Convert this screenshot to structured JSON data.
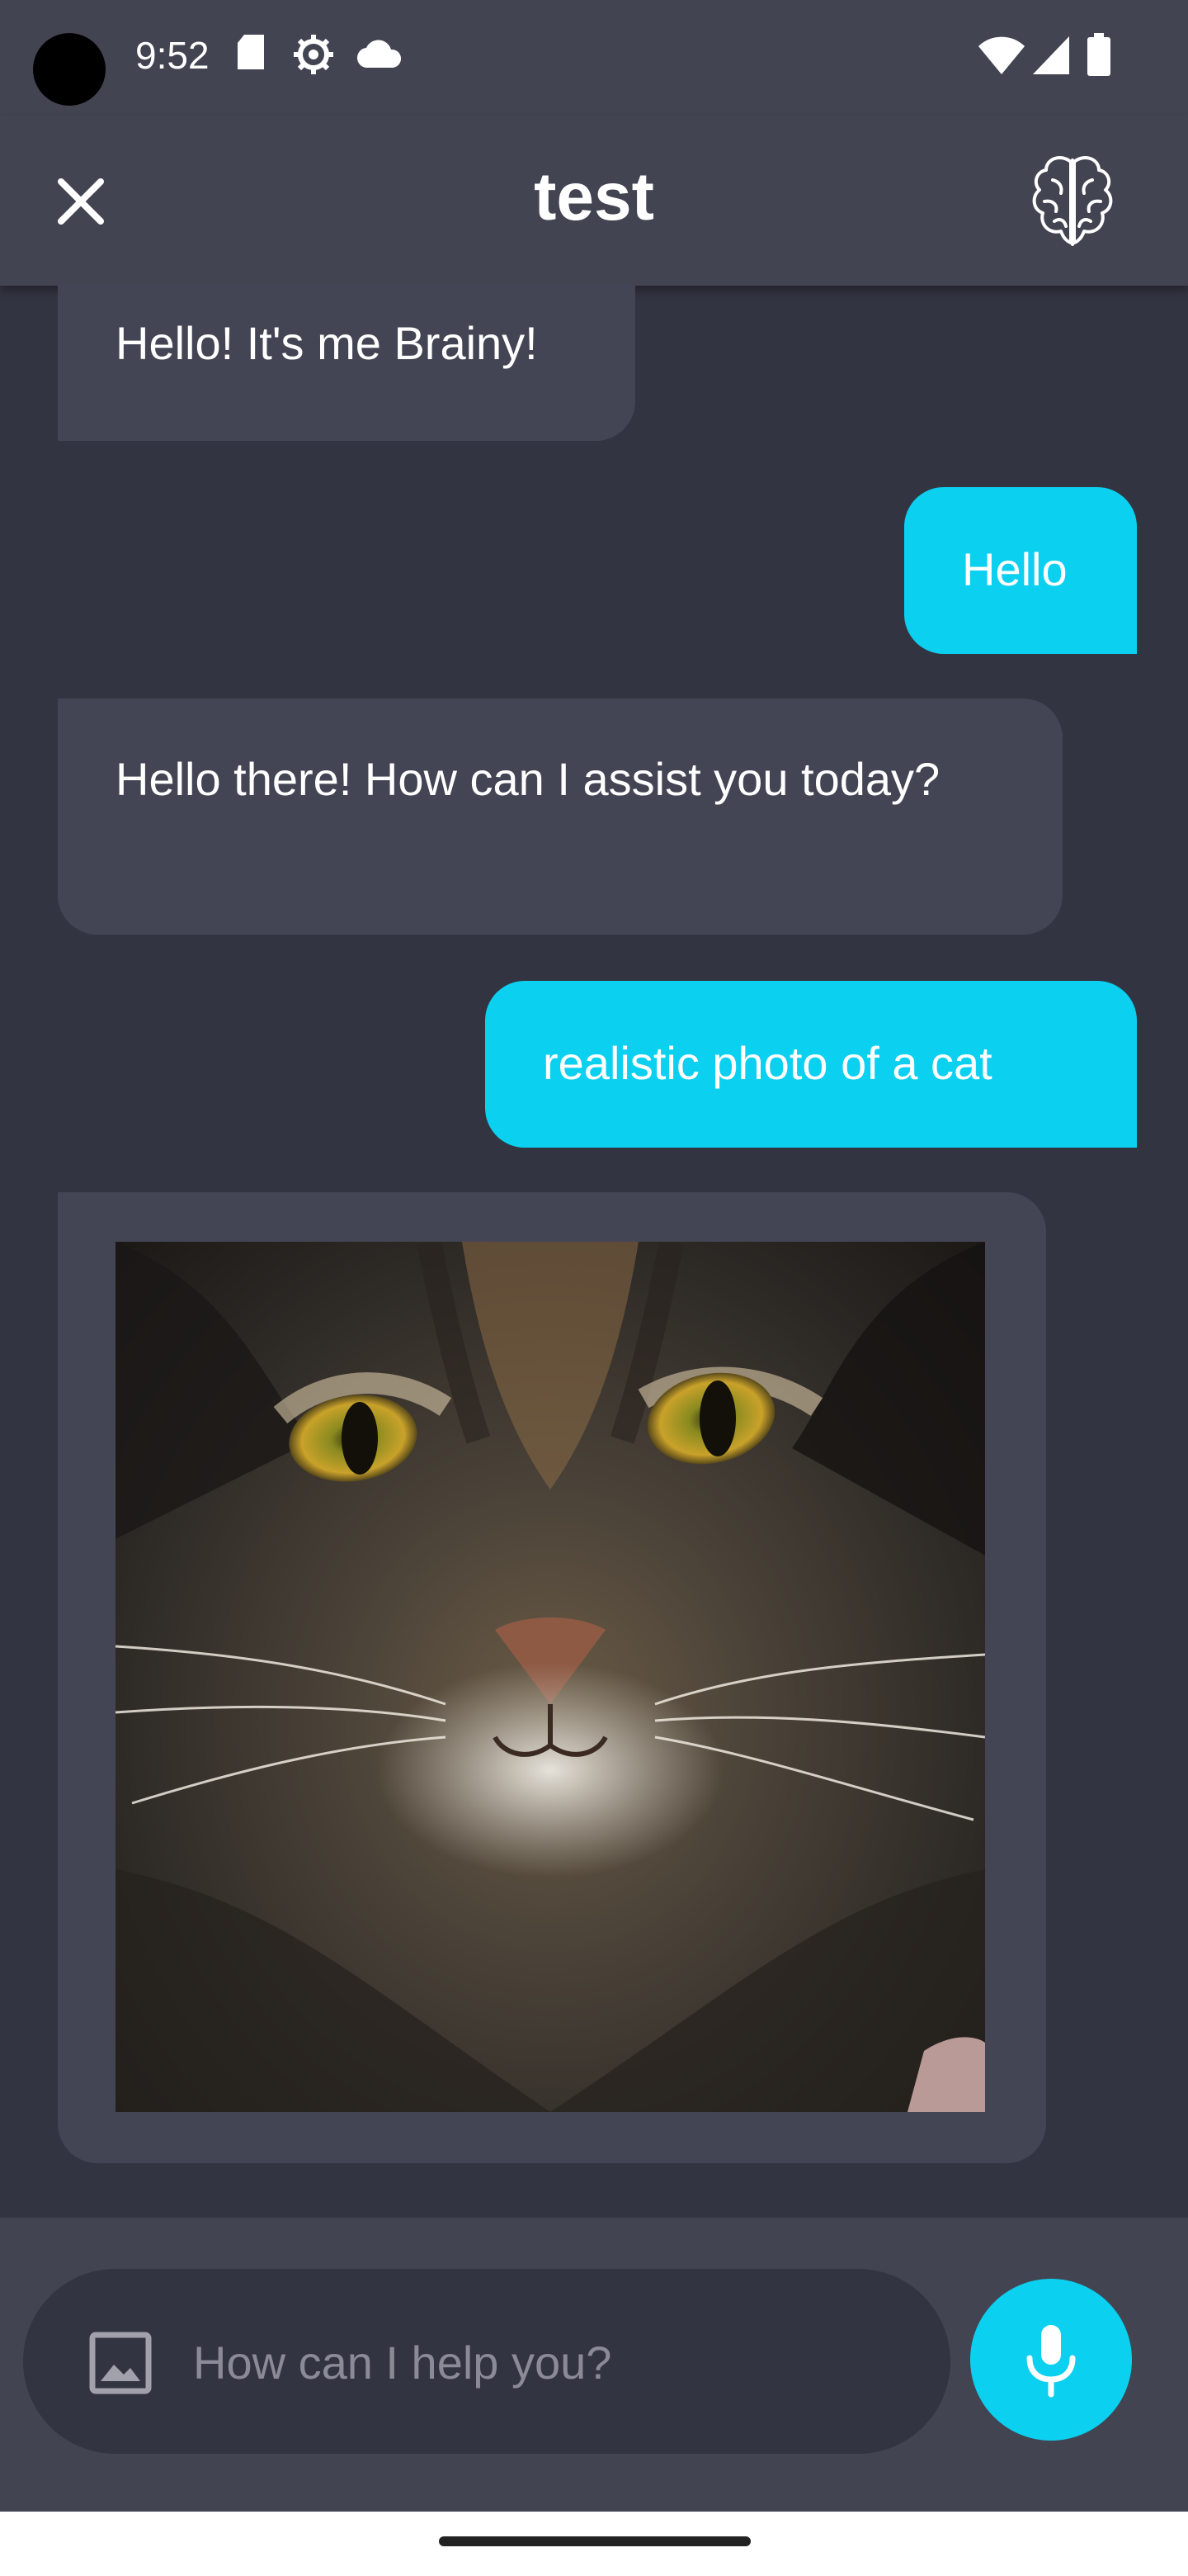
{
  "status_bar": {
    "time": "9:52",
    "icons_left": [
      "sd-card-icon",
      "settings-gear-icon",
      "cloud-icon"
    ],
    "icons_right": [
      "wifi-icon",
      "cell-signal-icon",
      "battery-icon"
    ]
  },
  "header": {
    "title": "test",
    "close_icon": "close-icon",
    "brain_icon": "brain-icon"
  },
  "messages": [
    {
      "role": "bot",
      "text": "Hello! It's me Brainy!"
    },
    {
      "role": "user",
      "text": "Hello"
    },
    {
      "role": "bot",
      "text": "Hello there! How can I assist you today?"
    },
    {
      "role": "user",
      "text": "realistic photo of a cat"
    },
    {
      "role": "bot",
      "type": "image",
      "image_alt": "cat"
    }
  ],
  "composer": {
    "placeholder": "How can I help you?",
    "value": "",
    "image_icon": "image-icon",
    "mic_icon": "microphone-icon"
  },
  "colors": {
    "background": "#333441",
    "surface": "#434452",
    "bot_bubble": "#444554",
    "accent": "#0bd0f0"
  }
}
